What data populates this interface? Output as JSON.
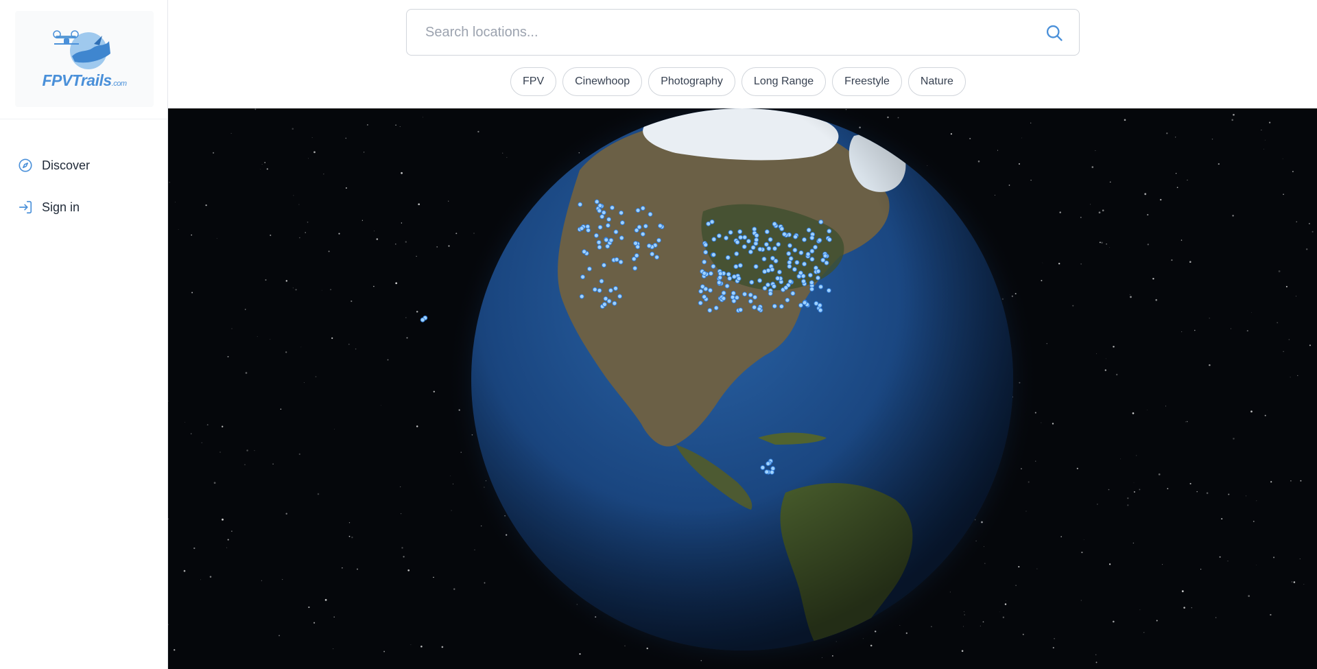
{
  "brand": {
    "name": "FPVTrails",
    "suffix": ".com"
  },
  "sidebar": {
    "items": [
      {
        "label": "Discover",
        "icon": "compass-icon"
      },
      {
        "label": "Sign in",
        "icon": "sign-in-icon"
      }
    ]
  },
  "search": {
    "placeholder": "Search locations...",
    "value": ""
  },
  "filters": [
    "FPV",
    "Cinewhoop",
    "Photography",
    "Long Range",
    "Freestyle",
    "Nature"
  ],
  "colors": {
    "accent": "#4a90d9",
    "space": "#05070b",
    "ocean": "#1d4f8c",
    "marker": "#9fd2ff"
  }
}
